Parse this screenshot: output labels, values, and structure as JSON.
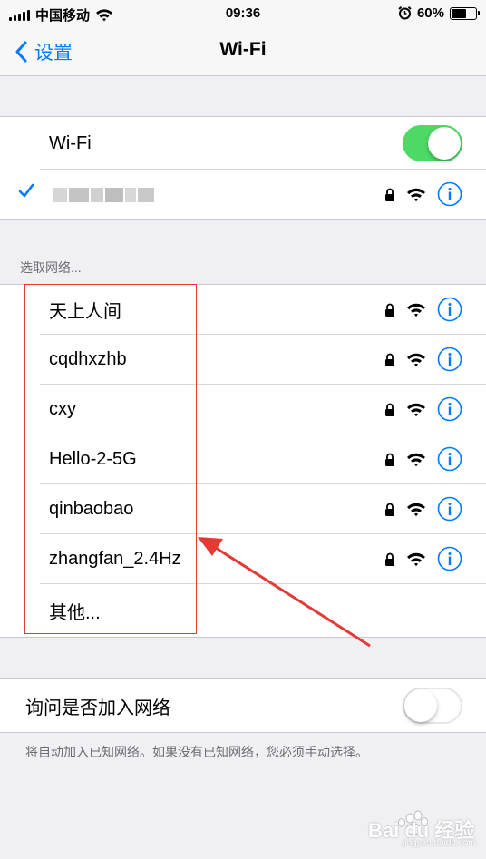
{
  "status_bar": {
    "carrier": "中国移动",
    "time": "09:36",
    "battery_percent": "60%",
    "battery_level": 0.6
  },
  "nav": {
    "back_label": "设置",
    "title": "Wi-Fi"
  },
  "wifi_toggle": {
    "label": "Wi-Fi",
    "on": true
  },
  "connected": {
    "secured": true
  },
  "networks_section": {
    "header": "选取网络...",
    "items": [
      {
        "name": "天上人间",
        "secured": true
      },
      {
        "name": "cqdhxzhb",
        "secured": true
      },
      {
        "name": "cxy",
        "secured": true
      },
      {
        "name": "Hello-2-5G",
        "secured": true
      },
      {
        "name": "qinbaobao",
        "secured": true
      },
      {
        "name": "zhangfan_2.4Hz",
        "secured": true
      }
    ],
    "other_label": "其他..."
  },
  "ask_join": {
    "label": "询问是否加入网络",
    "on": false,
    "note": "将自动加入已知网络。如果没有已知网络，您必须手动选择。"
  },
  "watermark": {
    "brand": "Bai du 经验",
    "url": "jingyan.baidu.com"
  },
  "colors": {
    "accent": "#007aff",
    "toggle_on": "#4cd964",
    "annotation": "#e53935"
  }
}
